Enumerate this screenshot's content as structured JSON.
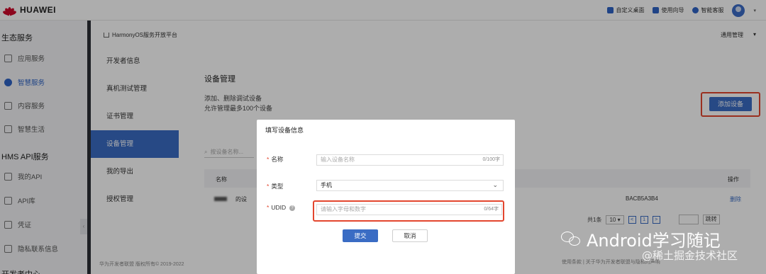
{
  "topbar": {
    "brand": "HUAWEI",
    "actions": [
      {
        "label": "自定义桌面",
        "icon": "dashboard-icon"
      },
      {
        "label": "使用向导",
        "icon": "guide-icon"
      },
      {
        "label": "智能客服",
        "icon": "support-icon"
      }
    ]
  },
  "leftnav": {
    "section1": "生态服务",
    "items1": [
      "应用服务",
      "智慧服务",
      "内容服务",
      "智慧生活"
    ],
    "section2": "HMS API服务",
    "items2": [
      "我的API",
      "API库",
      "凭证",
      "隐私联系信息"
    ],
    "section3": "开发者中心",
    "collapse_glyph": "‹"
  },
  "main": {
    "breadcrumb": "HarmonyOS服务开放平台",
    "manage_menu": "通用管理",
    "manage_caret": "▾",
    "submenu": [
      "开发者信息",
      "真机测试管理",
      "证书管理",
      "设备管理",
      "我的导出",
      "授权管理"
    ],
    "footer": "华为开发者联盟 版权所有© 2019-2022",
    "title": "设备管理",
    "desc1": "添加、删除调试设备",
    "desc2": "允许管理最多100个设备",
    "add_button": "添加设备",
    "search_placeholder": "按设备名称...",
    "table": {
      "col_name": "名称",
      "col_op": "操作",
      "row_name_suffix": "的设",
      "row_id_fragment": "BACB5A3B4",
      "row_op": "删除"
    },
    "pager": {
      "total": "共1条",
      "page_size": "10",
      "prev": "<",
      "current": "1",
      "next": ">",
      "go": "跳转"
    },
    "bottom_links": "使用条款 | 关于华为开发者联盟与隐私的声明"
  },
  "modal": {
    "title": "填写设备信息",
    "required_mark": "*",
    "name_label": "名称",
    "name_placeholder": "输入设备名称",
    "name_counter": "0/100字",
    "type_label": "类型",
    "type_value": "手机",
    "udid_label": "UDID",
    "udid_help": "?",
    "udid_placeholder": "请输入字母和数字",
    "udid_counter": "0/64字",
    "submit": "提交",
    "cancel": "取消"
  },
  "watermark": {
    "line1": "Android学习随记",
    "line2": "@稀土掘金技术社区"
  },
  "colors": {
    "primary": "#3a6cc4",
    "highlight": "#e3462e",
    "brand": "#cf0a2c"
  }
}
